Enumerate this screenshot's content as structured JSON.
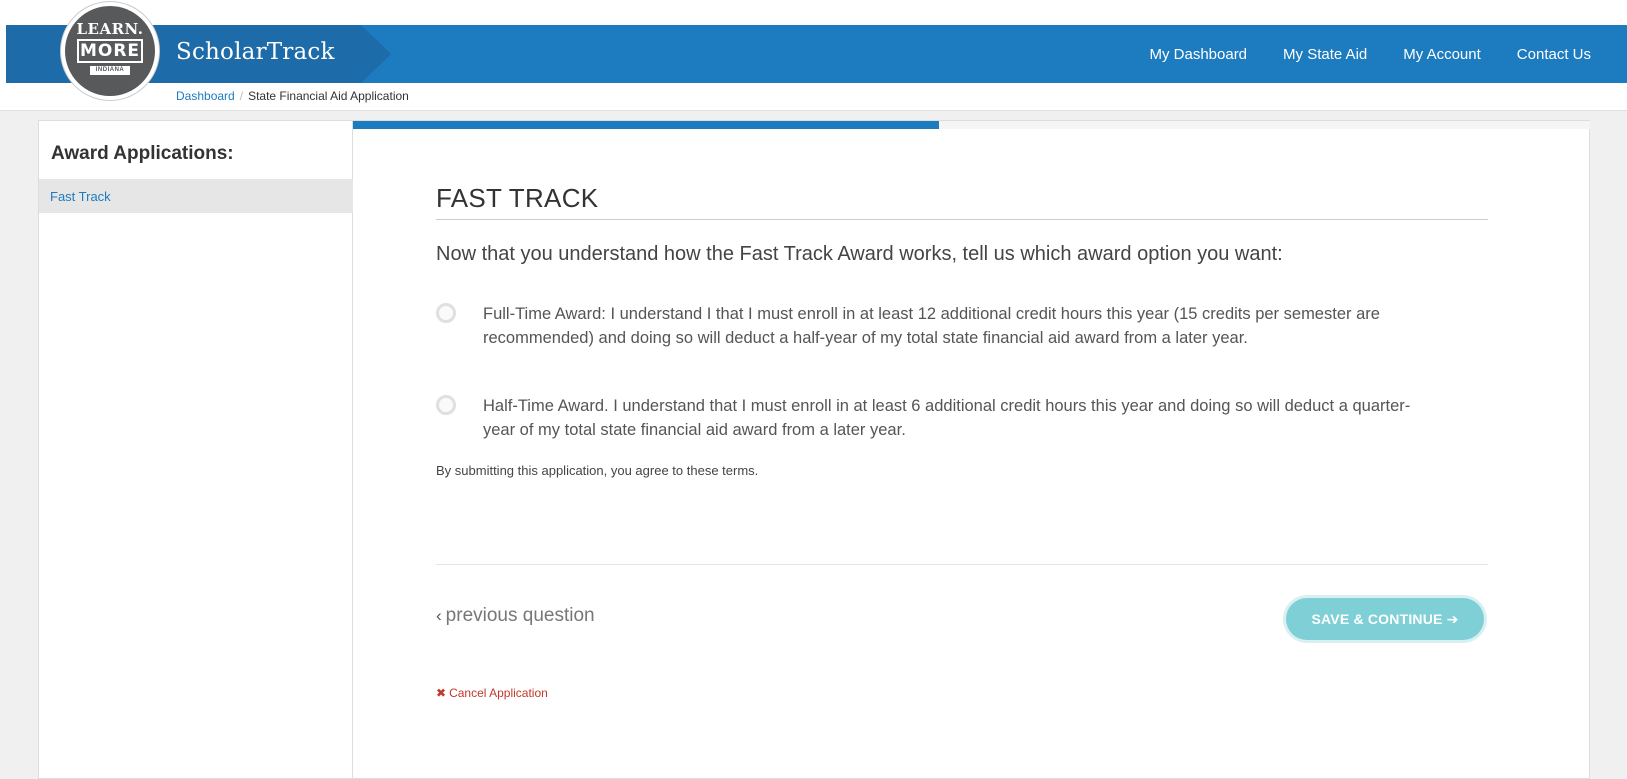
{
  "brand": {
    "logo_learn": "LEARN.",
    "logo_more": "MORE",
    "logo_indiana": "INDIANA",
    "app_name": "ScholarTrack"
  },
  "nav": {
    "items": [
      {
        "label": "My Dashboard"
      },
      {
        "label": "My State Aid"
      },
      {
        "label": "My Account"
      },
      {
        "label": "Contact Us"
      }
    ]
  },
  "breadcrumb": {
    "home": "Dashboard",
    "separator": "/",
    "current": "State Financial Aid Application"
  },
  "sidebar": {
    "title": "Award Applications:",
    "items": [
      {
        "label": "Fast Track",
        "active": true
      }
    ]
  },
  "progress": {
    "fraction": 0.474
  },
  "main": {
    "section_title": "FAST TRACK",
    "question": "Now that you understand how the Fast Track Award works, tell us which award option you want:",
    "options": [
      {
        "text": "Full-Time Award: I understand I that I must enroll in at least 12 additional credit hours this year (15 credits per semester are recommended) and doing so will deduct a half-year of my total state financial aid award from a later year.",
        "selected": false
      },
      {
        "text": "Half-Time Award. I understand that I must enroll in at least 6 additional credit hours this year and doing so will deduct a quarter-year of my total state financial aid award from a later year.",
        "selected": false
      }
    ],
    "terms": "By submitting this application, you agree to these terms.",
    "previous_label": "previous question",
    "save_label": "SAVE & CONTINUE",
    "cancel_label": "Cancel Application"
  },
  "colors": {
    "nav_blue": "#1d7bc0",
    "brand_dark_blue": "#1d6ba8",
    "save_button": "#7ecfd6",
    "cancel_red": "#c0392b",
    "link_blue": "#1d7bc0"
  },
  "icons": {
    "previous": "chevron-left-icon",
    "save": "arrow-right-icon",
    "cancel": "close-icon"
  }
}
